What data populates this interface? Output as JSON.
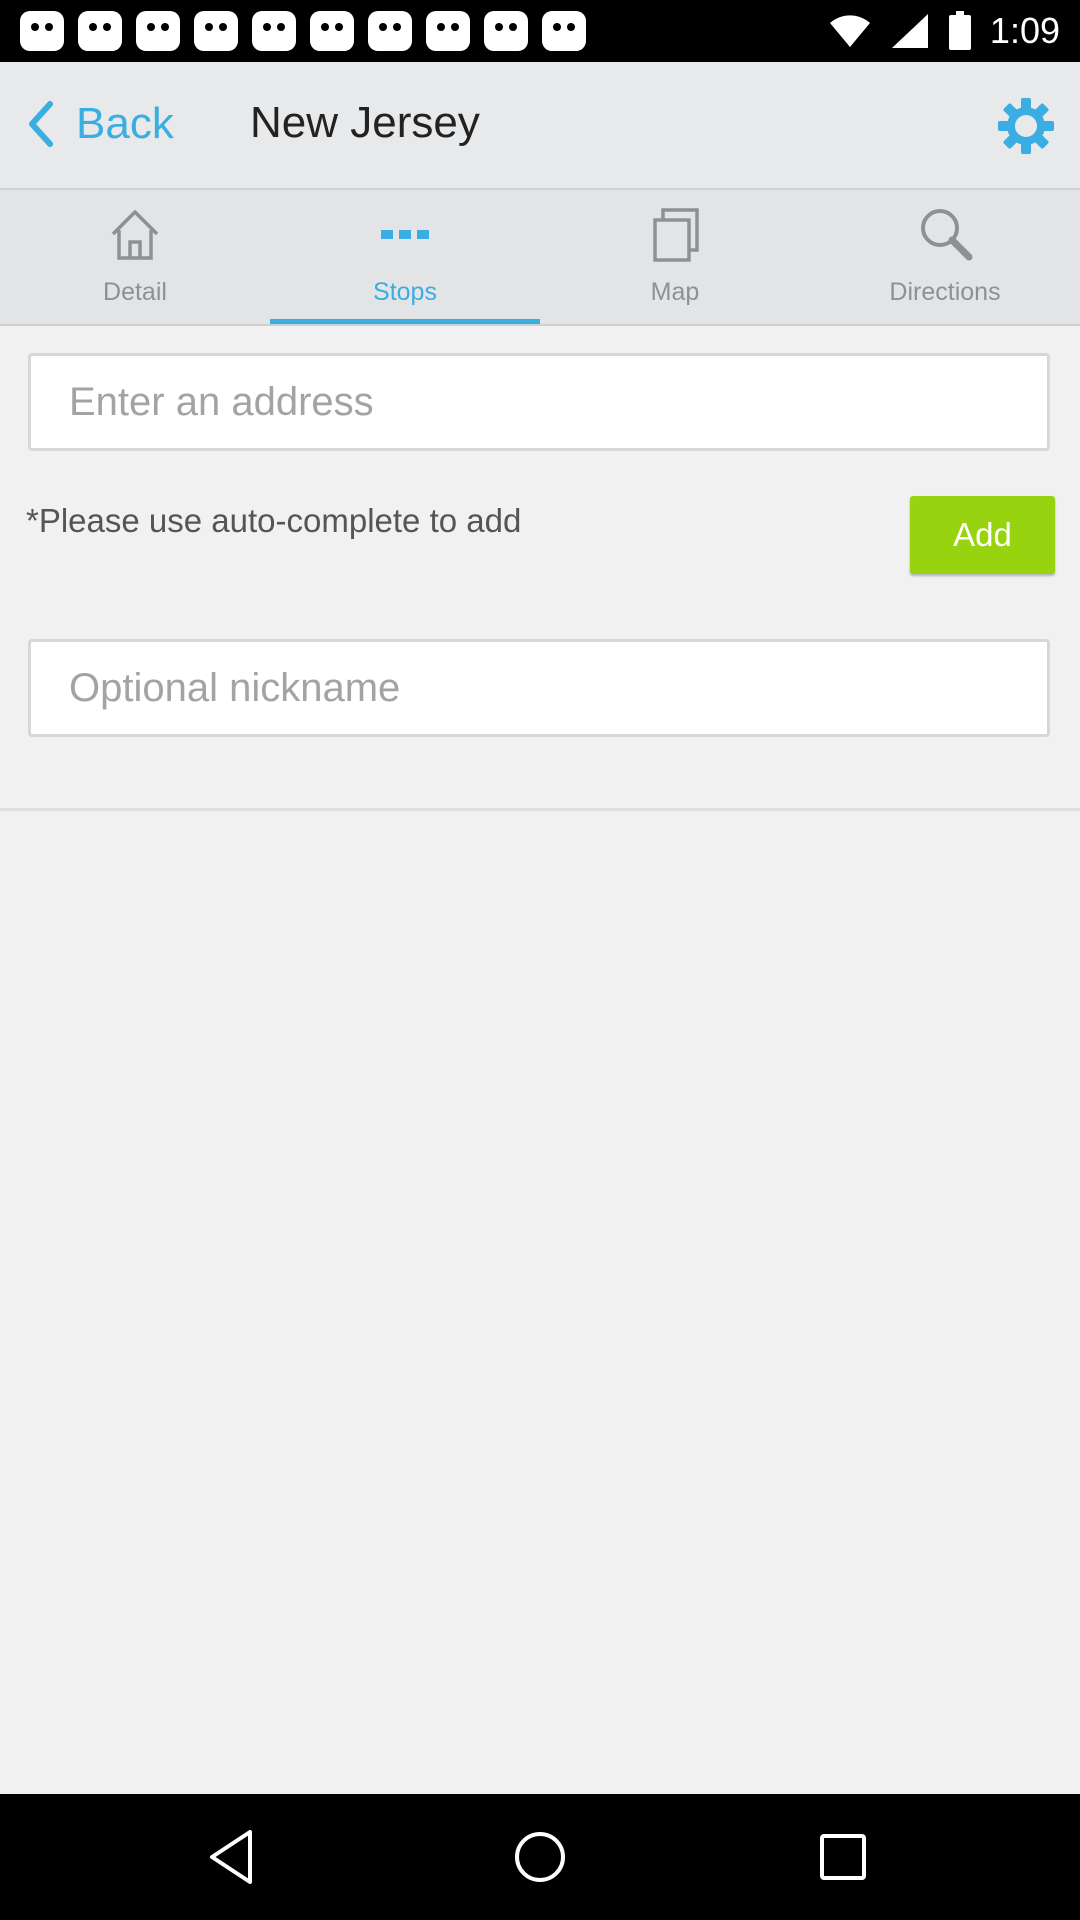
{
  "status_bar": {
    "time": "1:09"
  },
  "header": {
    "back_label": "Back",
    "title": "New Jersey"
  },
  "tabs": [
    {
      "label": "Detail",
      "icon": "home-icon",
      "active": false
    },
    {
      "label": "Stops",
      "icon": "dots-icon",
      "active": true
    },
    {
      "label": "Map",
      "icon": "copy-icon",
      "active": false
    },
    {
      "label": "Directions",
      "icon": "search-icon",
      "active": false
    }
  ],
  "form": {
    "address_placeholder": "Enter an address",
    "address_value": "",
    "hint": "*Please use auto-complete to add",
    "add_label": "Add",
    "nickname_placeholder": "Optional nickname",
    "nickname_value": ""
  },
  "colors": {
    "accent": "#3aaee2",
    "add_button": "#97d30f"
  }
}
